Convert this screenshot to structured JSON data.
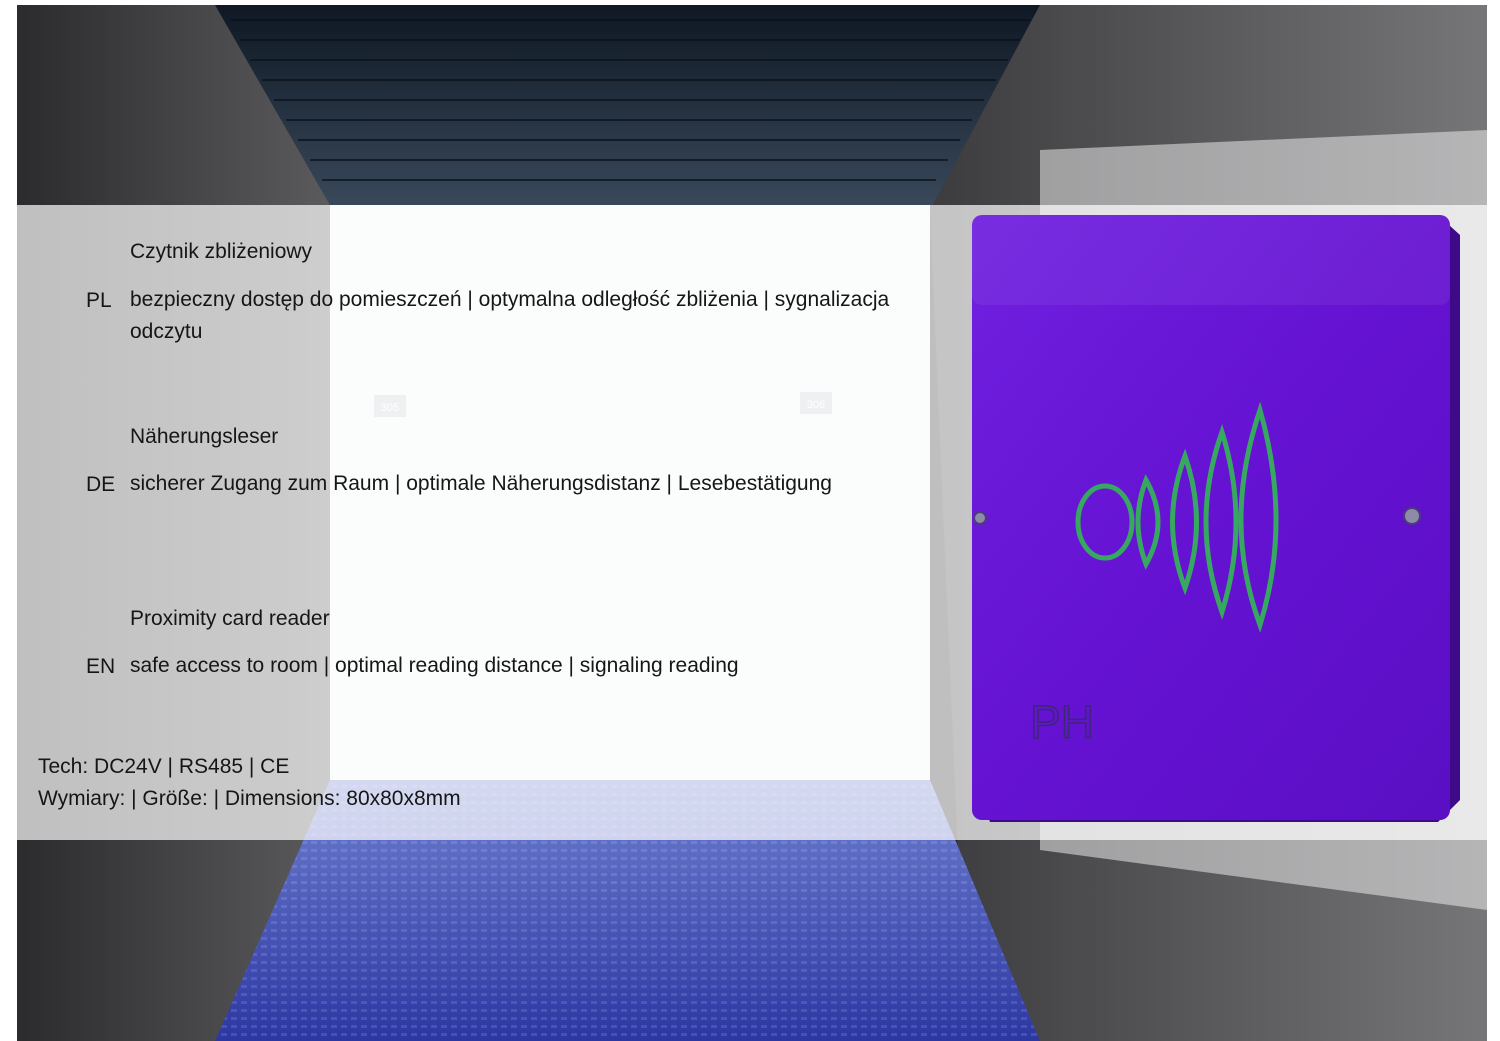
{
  "scene": {
    "door_numbers": [
      "305",
      "306"
    ]
  },
  "entries": [
    {
      "code": "PL",
      "heading": "Czytnik zbliżeniowy",
      "description": "bezpieczny dostęp do pomieszczeń | optymalna odległość zbliżenia | sygnalizacja odczytu"
    },
    {
      "code": "DE",
      "heading": "Näherungsleser",
      "description": "sicherer Zugang zum Raum | optimale Näherungsdistanz | Lesebestätigung"
    },
    {
      "code": "EN",
      "heading": "Proximity card reader",
      "description": "safe access to room | optimal reading distance | signaling reading"
    }
  ],
  "tech": {
    "line1": "Tech: DC24V | RS485 | CE",
    "line2": "Wymiary: | Größe: | Dimensions: 80x80x8mm"
  },
  "product": {
    "logo_text": "PH",
    "face_color": "#6a14d6",
    "symbol_color": "#37a860"
  }
}
